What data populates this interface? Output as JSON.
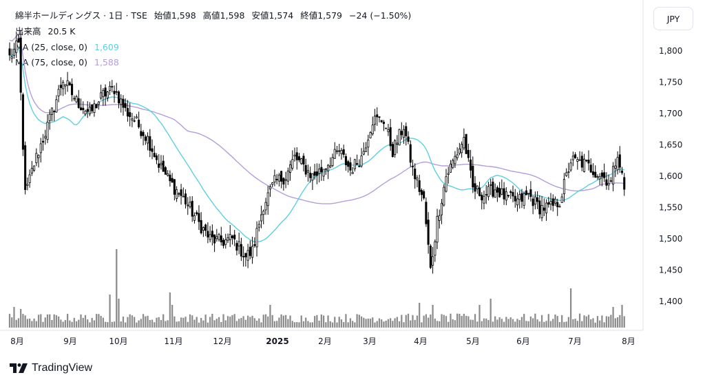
{
  "header": {
    "title": "綿半ホールディングス · 1日 · TSE",
    "open": "始値1,598",
    "high": "高値1,598",
    "low": "安値1,574",
    "close": "終値1,579",
    "change": "−24 (−1.50%)",
    "volume_label": "出来高",
    "volume_value": "20.5 K",
    "ma25_label": "MA (25, close, 0)",
    "ma25_value": "1,609",
    "ma75_label": "MA (75, close, 0)",
    "ma75_value": "1,588"
  },
  "currency_button": "JPY",
  "logo_text": "TradingView",
  "colors": {
    "ma25": "#5ccfe0",
    "ma75": "#b39ddb",
    "volume": "#8c8c8c",
    "candle": "#000000"
  },
  "chart_data": {
    "type": "candlestick",
    "y_axis": {
      "ticks": [
        "1,800",
        "1,750",
        "1,700",
        "1,650",
        "1,600",
        "1,550",
        "1,500",
        "1,450",
        "1,400"
      ],
      "tick_values": [
        1800,
        1750,
        1700,
        1650,
        1600,
        1550,
        1500,
        1450,
        1400
      ],
      "ylim": [
        1358,
        1832
      ]
    },
    "x_axis": {
      "labels": [
        "8月",
        "9月",
        "10月",
        "11月",
        "12月",
        "2025",
        "2月",
        "3月",
        "4月",
        "5月",
        "6月",
        "7月",
        "8月"
      ]
    },
    "anchors": [
      {
        "t": 0,
        "v": 1790
      },
      {
        "t": 4,
        "v": 1810
      },
      {
        "t": 7,
        "v": 1570
      },
      {
        "t": 11,
        "v": 1620
      },
      {
        "t": 17,
        "v": 1680
      },
      {
        "t": 24,
        "v": 1755
      },
      {
        "t": 30,
        "v": 1720
      },
      {
        "t": 36,
        "v": 1700
      },
      {
        "t": 42,
        "v": 1730
      },
      {
        "t": 47,
        "v": 1740
      },
      {
        "t": 52,
        "v": 1705
      },
      {
        "t": 56,
        "v": 1690
      },
      {
        "t": 62,
        "v": 1660
      },
      {
        "t": 67,
        "v": 1620
      },
      {
        "t": 72,
        "v": 1590
      },
      {
        "t": 79,
        "v": 1560
      },
      {
        "t": 85,
        "v": 1525
      },
      {
        "t": 90,
        "v": 1500
      },
      {
        "t": 95,
        "v": 1495
      },
      {
        "t": 100,
        "v": 1500
      },
      {
        "t": 106,
        "v": 1472
      },
      {
        "t": 109,
        "v": 1480
      },
      {
        "t": 114,
        "v": 1555
      },
      {
        "t": 119,
        "v": 1590
      },
      {
        "t": 124,
        "v": 1600
      },
      {
        "t": 128,
        "v": 1630
      },
      {
        "t": 132,
        "v": 1615
      },
      {
        "t": 136,
        "v": 1600
      },
      {
        "t": 140,
        "v": 1610
      },
      {
        "t": 144,
        "v": 1625
      },
      {
        "t": 148,
        "v": 1640
      },
      {
        "t": 153,
        "v": 1610
      },
      {
        "t": 158,
        "v": 1630
      },
      {
        "t": 163,
        "v": 1690
      },
      {
        "t": 168,
        "v": 1690
      },
      {
        "t": 172,
        "v": 1640
      },
      {
        "t": 177,
        "v": 1680
      },
      {
        "t": 181,
        "v": 1610
      },
      {
        "t": 186,
        "v": 1560
      },
      {
        "t": 189,
        "v": 1450
      },
      {
        "t": 192,
        "v": 1530
      },
      {
        "t": 196,
        "v": 1600
      },
      {
        "t": 200,
        "v": 1630
      },
      {
        "t": 204,
        "v": 1660
      },
      {
        "t": 208,
        "v": 1580
      },
      {
        "t": 213,
        "v": 1570
      },
      {
        "t": 218,
        "v": 1580
      },
      {
        "t": 223,
        "v": 1565
      },
      {
        "t": 228,
        "v": 1560
      },
      {
        "t": 233,
        "v": 1570
      },
      {
        "t": 238,
        "v": 1550
      },
      {
        "t": 243,
        "v": 1550
      },
      {
        "t": 247,
        "v": 1560
      },
      {
        "t": 252,
        "v": 1625
      },
      {
        "t": 258,
        "v": 1620
      },
      {
        "t": 262,
        "v": 1610
      },
      {
        "t": 266,
        "v": 1600
      },
      {
        "t": 270,
        "v": 1590
      },
      {
        "t": 273,
        "v": 1640
      },
      {
        "t": 276,
        "v": 1579
      }
    ],
    "volume_peaks": [
      {
        "t": 2,
        "v": 0.5
      },
      {
        "t": 5,
        "v": 0.45
      },
      {
        "t": 45,
        "v": 0.8
      },
      {
        "t": 48,
        "v": 1.9
      },
      {
        "t": 49,
        "v": 0.7
      },
      {
        "t": 72,
        "v": 0.85
      },
      {
        "t": 73,
        "v": 0.55
      },
      {
        "t": 117,
        "v": 0.55
      },
      {
        "t": 184,
        "v": 0.6
      },
      {
        "t": 190,
        "v": 0.55
      },
      {
        "t": 211,
        "v": 0.55
      },
      {
        "t": 216,
        "v": 0.7
      },
      {
        "t": 252,
        "v": 0.95
      },
      {
        "t": 271,
        "v": 0.5
      },
      {
        "t": 275,
        "v": 0.55
      }
    ]
  }
}
